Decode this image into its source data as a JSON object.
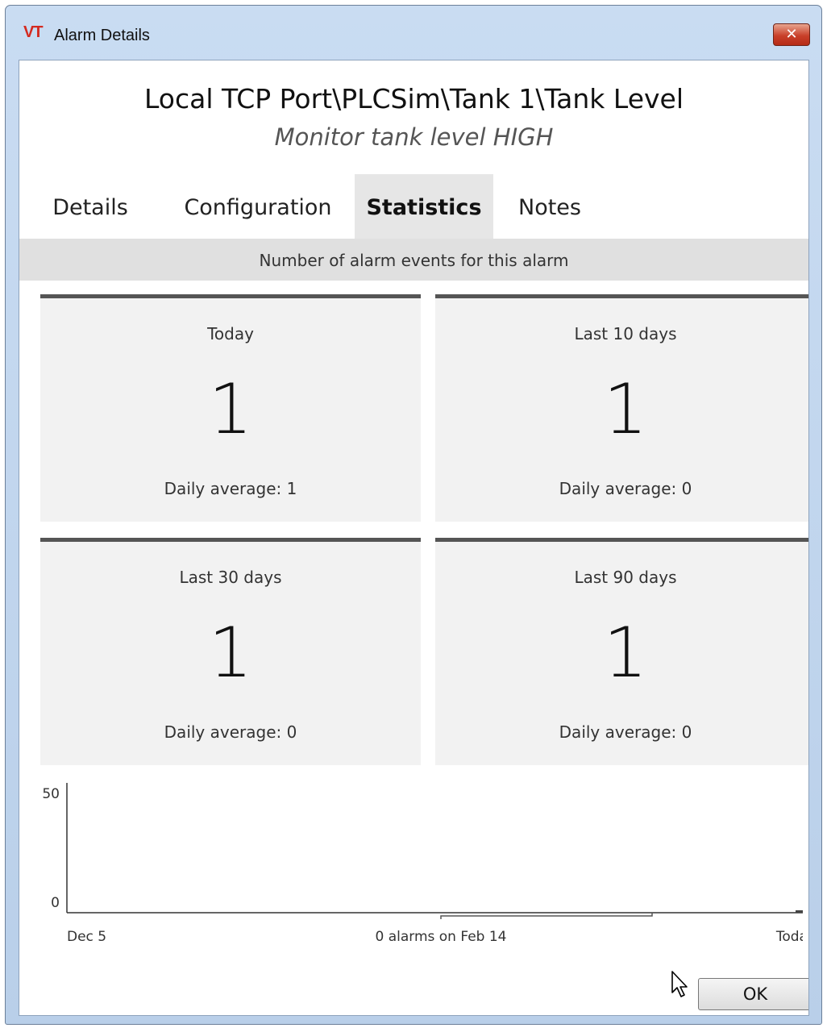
{
  "window": {
    "title": "Alarm Details",
    "logo_text": "VT",
    "close_symbol": "✕"
  },
  "alarm": {
    "name": "Local TCP Port\\PLCSim\\Tank 1\\Tank Level",
    "description": "Monitor tank level HIGH"
  },
  "tabs": [
    {
      "label": "Details",
      "active": false
    },
    {
      "label": "Configuration",
      "active": false
    },
    {
      "label": "Statistics",
      "active": true
    },
    {
      "label": "Notes",
      "active": false
    }
  ],
  "statistics": {
    "header": "Number of alarm events for this alarm",
    "cards": [
      {
        "title": "Today",
        "count": "1",
        "daily_average": "Daily average: 1"
      },
      {
        "title": "Last 10 days",
        "count": "1",
        "daily_average": "Daily average: 0"
      },
      {
        "title": "Last 30 days",
        "count": "1",
        "daily_average": "Daily average: 0"
      },
      {
        "title": "Last 90 days",
        "count": "1",
        "daily_average": "Daily average: 0"
      }
    ]
  },
  "chart_data": {
    "type": "bar",
    "y_ticks": [
      "50",
      "0"
    ],
    "ylim": [
      0,
      50
    ],
    "x_labels": {
      "start": "Dec 5",
      "end": "Today"
    },
    "tooltip": "0 alarms on Feb 14",
    "values": [
      0,
      1
    ]
  },
  "footer": {
    "ok_label": "OK"
  },
  "colors": {
    "accent_border": "#555555",
    "card_bg": "#f2f2f2",
    "header_bg": "#e0e0e0",
    "close_red": "#c9402a"
  }
}
